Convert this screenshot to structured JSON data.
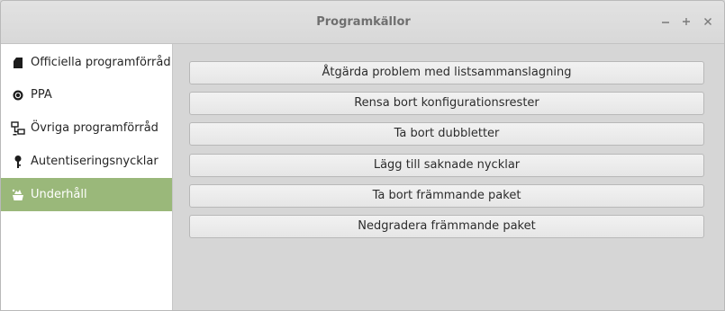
{
  "window": {
    "title": "Programkällor",
    "controls": {
      "minimize_icon": "minimize-icon",
      "maximize_icon": "maximize-icon",
      "close_icon": "close-icon"
    }
  },
  "sidebar": {
    "items": [
      {
        "label": "Officiella programförråd",
        "icon": "package-icon",
        "active": false
      },
      {
        "label": "PPA",
        "icon": "ppa-icon",
        "active": false
      },
      {
        "label": "Övriga programförråd",
        "icon": "network-icon",
        "active": false
      },
      {
        "label": "Autentiseringsnycklar",
        "icon": "key-icon",
        "active": false
      },
      {
        "label": "Underhåll",
        "icon": "maintenance-icon",
        "active": true
      }
    ]
  },
  "maintenance": {
    "buttons": [
      "Åtgärda problem med listsammanslagning",
      "Rensa bort konfigurationsrester",
      "Ta bort dubbletter",
      "Lägg till saknade nycklar",
      "Ta bort främmande paket",
      "Nedgradera främmande paket"
    ]
  },
  "colors": {
    "accent": "#9ab87a",
    "sidebar_bg": "#ffffff",
    "content_bg": "#d6d6d6"
  }
}
